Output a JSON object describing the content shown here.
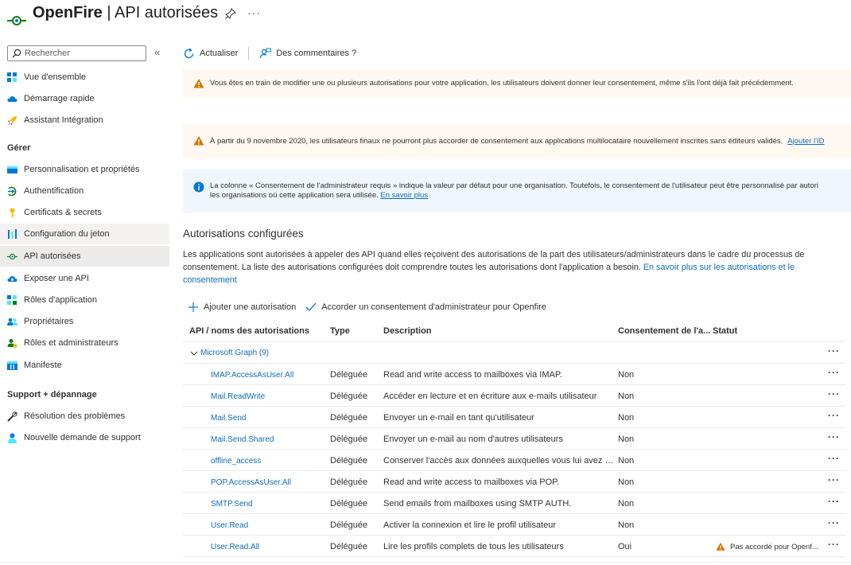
{
  "header": {
    "app_name": "OpenFire",
    "separator": " | ",
    "page_name": "API autorisées",
    "more": "···"
  },
  "colors": {
    "accent": "#0f6cbd",
    "warning": "#d47500",
    "info": "#0078d4",
    "selected_bg": "#edebe9"
  },
  "sidebar": {
    "search_placeholder": "Rechercher",
    "collapse": "«",
    "items": [
      {
        "label": "Vue d'ensemble",
        "icon": "overview-grid-icon"
      },
      {
        "label": "Démarrage rapide",
        "icon": "cloud-quickstart-icon"
      },
      {
        "label": "Assistant Intégration",
        "icon": "rocket-icon"
      },
      {
        "label": "Personnalisation et propriétés",
        "icon": "branding-icon"
      },
      {
        "label": "Authentification",
        "icon": "authentication-icon"
      },
      {
        "label": "Certificats & secrets",
        "icon": "key-icon"
      },
      {
        "label": "Configuration du jeton",
        "icon": "token-bars-icon"
      },
      {
        "label": "API autorisées",
        "icon": "api-permissions-icon"
      },
      {
        "label": "Exposer une API",
        "icon": "cloud-api-icon"
      },
      {
        "label": "Rôles d'application",
        "icon": "app-roles-icon"
      },
      {
        "label": "Propriétaires",
        "icon": "owners-icon"
      },
      {
        "label": "Rôles et administrateurs",
        "icon": "roles-admins-icon"
      },
      {
        "label": "Manifeste",
        "icon": "manifest-icon"
      },
      {
        "label": "Résolution des problèmes",
        "icon": "wrench-icon"
      },
      {
        "label": "Nouvelle demande de support",
        "icon": "support-person-icon"
      }
    ],
    "groups": {
      "manage": "Gérer",
      "support": "Support + dépannage"
    }
  },
  "toolbar": {
    "refresh": "Actualiser",
    "feedback": "Des commentaires ?"
  },
  "banners": {
    "warn1": "Vous êtes en train de modifier une ou plusieurs autorisations pour votre application, les utilisateurs doivent donner leur consentement, même s'ils l'ont déjà fait précédemment.",
    "warn2": "À partir du 9 novembre 2020, les utilisateurs finaux ne pourront plus accorder de consentement aux applications multilocataire nouvellement inscrites sans éditeurs validés.",
    "warn2_link": "Ajouter l'ID",
    "info_line1": "La colonne « Consentement de l'administrateur requis » indique la valeur par défaut pour une organisation. Toutefois, le consentement de l'utilisateur peut être personnalisé par autori",
    "info_line2": "les organisations où cette application sera utilisée.",
    "info_link": "En savoir plus"
  },
  "section": {
    "title": "Autorisations configurées",
    "desc": "Les applications sont autorisées à appeler des API quand elles reçoivent des autorisations de la part des utilisateurs/administrateurs dans le cadre du processus de consentement. La liste des autorisations configurées doit comprendre toutes les autorisations dont l'application a besoin.",
    "desc_link": "En savoir plus sur les autorisations et le consentement"
  },
  "actions": {
    "add": "Ajouter une autorisation",
    "grant": "Accorder un consentement d'administrateur pour Openfire"
  },
  "table": {
    "headers": {
      "api": "API / noms des autorisations",
      "type": "Type",
      "description": "Description",
      "consent": "Consentement de l'a...",
      "status": "Statut"
    },
    "group": "Microsoft Graph (9)",
    "rows": [
      {
        "name": "IMAP.AccessAsUser.All",
        "type": "Déléguée",
        "description": "Read and write access to mailboxes via IMAP.",
        "consent": "Non",
        "status": ""
      },
      {
        "name": "Mail.ReadWrite",
        "type": "Déléguée",
        "description": "Accéder en lecture et en écriture aux e-mails utilisateur",
        "consent": "Non",
        "status": ""
      },
      {
        "name": "Mail.Send",
        "type": "Déléguée",
        "description": "Envoyer un e-mail en tant qu'utilisateur",
        "consent": "Non",
        "status": ""
      },
      {
        "name": "Mail.Send.Shared",
        "type": "Déléguée",
        "description": "Envoyer un e-mail au nom d'autres utilisateurs",
        "consent": "Non",
        "status": ""
      },
      {
        "name": "offline_access",
        "type": "Déléguée",
        "description": "Conserver l'accès aux données auxquelles vous lui avez do...",
        "consent": "Non",
        "status": ""
      },
      {
        "name": "POP.AccessAsUser.All",
        "type": "Déléguée",
        "description": "Read and write access to mailboxes via POP.",
        "consent": "Non",
        "status": ""
      },
      {
        "name": "SMTP.Send",
        "type": "Déléguée",
        "description": "Send emails from mailboxes using SMTP AUTH.",
        "consent": "Non",
        "status": ""
      },
      {
        "name": "User.Read",
        "type": "Déléguée",
        "description": "Activer la connexion et lire le profil utilisateur",
        "consent": "Non",
        "status": ""
      },
      {
        "name": "User.Read.All",
        "type": "Déléguée",
        "description": "Lire les profils complets de tous les utilisateurs",
        "consent": "Oui",
        "status": "Pas accordé pour Openf..."
      }
    ],
    "more": "···"
  }
}
